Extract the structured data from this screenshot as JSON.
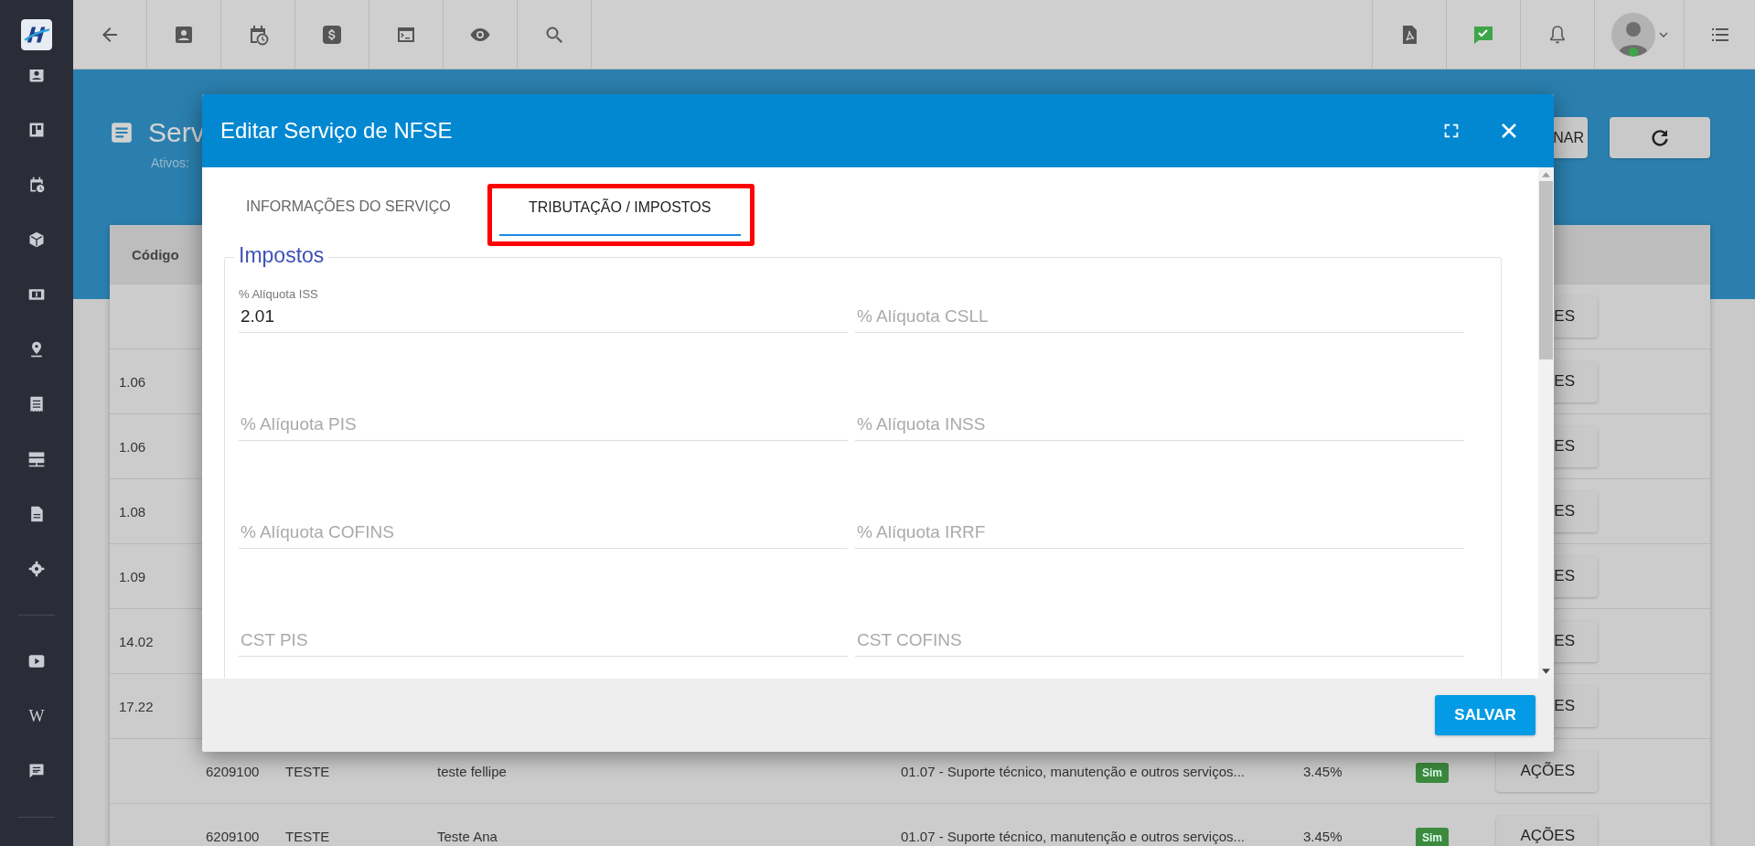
{
  "sidebar": {
    "glyph": "W"
  },
  "page": {
    "title": "Serv",
    "subtitle": "Ativos:",
    "buttons": [
      {
        "label": "NAR"
      }
    ]
  },
  "table": {
    "columns": [
      "Código"
    ],
    "rows": [
      {
        "codigo": "",
        "cnae": "",
        "nome": "",
        "descricao": "",
        "servico": "",
        "aliquota": "",
        "ativo": "",
        "acao": "ES"
      },
      {
        "codigo": "1.06",
        "cnae": "",
        "nome": "",
        "descricao": "",
        "servico": "",
        "aliquota": "",
        "ativo": "",
        "acao": "ES"
      },
      {
        "codigo": "1.06",
        "cnae": "",
        "nome": "",
        "descricao": "",
        "servico": "",
        "aliquota": "",
        "ativo": "",
        "acao": "ES"
      },
      {
        "codigo": "1.08",
        "cnae": "",
        "nome": "",
        "descricao": "",
        "servico": "",
        "aliquota": "",
        "ativo": "",
        "acao": "ES"
      },
      {
        "codigo": "1.09",
        "cnae": "",
        "nome": "",
        "descricao": "",
        "servico": "",
        "aliquota": "",
        "ativo": "",
        "acao": "ES"
      },
      {
        "codigo": "14.02",
        "cnae": "",
        "nome": "",
        "descricao": "",
        "servico": "",
        "aliquota": "",
        "ativo": "",
        "acao": "ES"
      },
      {
        "codigo": "17.22",
        "cnae": "",
        "nome": "",
        "descricao": "",
        "servico": "",
        "aliquota": "",
        "ativo": "",
        "acao": "ES"
      },
      {
        "codigo": "",
        "cnae": "6209100",
        "nome": "TESTE",
        "descricao": "teste fellipe",
        "servico": "01.07 - Suporte técnico, manutenção e outros serviços...",
        "aliquota": "3.45%",
        "ativo": "Sim",
        "acao": "AÇÕES"
      },
      {
        "codigo": "",
        "cnae": "6209100",
        "nome": "TESTE",
        "descricao": "Teste Ana",
        "servico": "01.07 - Suporte técnico, manutenção e outros serviços...",
        "aliquota": "3.45%",
        "ativo": "Sim",
        "acao": "AÇÕES"
      }
    ]
  },
  "modal": {
    "title": "Editar Serviço de NFSE",
    "tabs": [
      {
        "label": "INFORMAÇÕES DO SERVIÇO",
        "selected": false
      },
      {
        "label": "TRIBUTAÇÃO / IMPOSTOS",
        "selected": true,
        "highlighted": true
      }
    ],
    "section": "Impostos",
    "fields": [
      {
        "label": "% Alíquota ISS",
        "value": "2.01"
      },
      {
        "placeholder": "% Alíquota CSLL"
      },
      {
        "placeholder": "% Alíquota PIS"
      },
      {
        "placeholder": "% Alíquota INSS"
      },
      {
        "placeholder": "% Alíquota COFINS"
      },
      {
        "placeholder": "% Alíquota IRRF"
      },
      {
        "placeholder": "CST PIS"
      },
      {
        "placeholder": "CST COFINS"
      }
    ],
    "save_button": "SALVAR"
  }
}
